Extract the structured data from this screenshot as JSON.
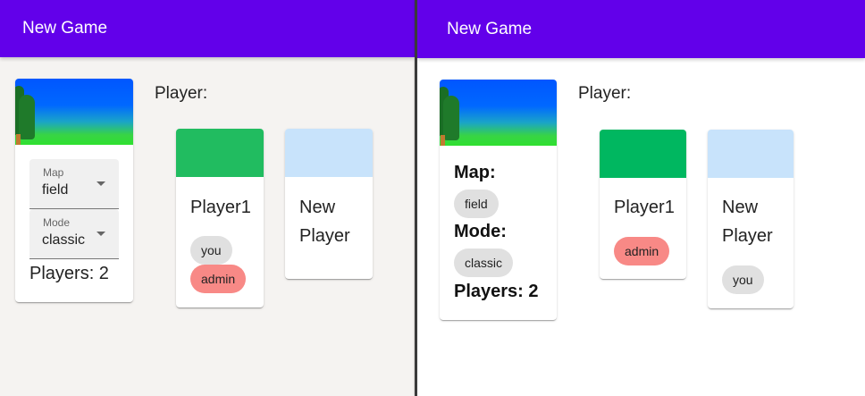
{
  "left": {
    "appbar": {
      "title": "New Game"
    },
    "map_card": {
      "map_select": {
        "label": "Map",
        "value": "field"
      },
      "mode_select": {
        "label": "Mode",
        "value": "classic"
      },
      "players_text": "Players: 2"
    },
    "section_title": "Player:",
    "players": [
      {
        "name": "Player1",
        "color": "#21bc60",
        "chips": [
          "you",
          "admin"
        ]
      },
      {
        "name_line1": "New",
        "name_line2": "Player",
        "color": "#c8e3fb",
        "chips": []
      }
    ]
  },
  "right": {
    "appbar": {
      "title": "New Game"
    },
    "map_card": {
      "map_label": "Map:",
      "map_value": "field",
      "mode_label": "Mode:",
      "mode_value": "classic",
      "players_text": "Players: 2"
    },
    "section_title": "Player:",
    "players": [
      {
        "name": "Player1",
        "color": "#00b760",
        "chips": [
          "admin"
        ]
      },
      {
        "name_line1": "New",
        "name_line2": "Player",
        "color": "#c8e3fb",
        "chips": [
          "you"
        ]
      }
    ]
  },
  "colors": {
    "appbar": "#6200ea",
    "admin_chip": "#f88986",
    "chip": "#e0e0e0"
  }
}
